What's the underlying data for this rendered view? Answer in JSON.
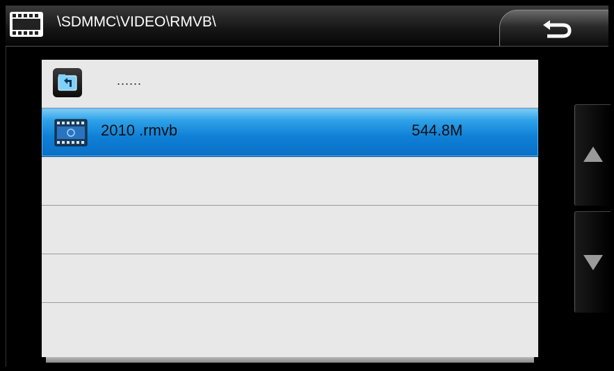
{
  "header": {
    "path": "\\SDMMC\\VIDEO\\RMVB\\",
    "icon": "film-icon",
    "back_icon": "back-arrow-icon"
  },
  "file_list": {
    "items": [
      {
        "type": "parent-folder",
        "label": "......",
        "size": ""
      },
      {
        "type": "video-file",
        "label": "2010 .rmvb",
        "size": "544.8M",
        "selected": true
      },
      {
        "type": "empty",
        "label": "",
        "size": ""
      },
      {
        "type": "empty",
        "label": "",
        "size": ""
      },
      {
        "type": "empty",
        "label": "",
        "size": ""
      },
      {
        "type": "empty",
        "label": "",
        "size": ""
      }
    ]
  },
  "scroll": {
    "up_icon": "triangle-up-icon",
    "down_icon": "triangle-down-icon"
  },
  "colors": {
    "selection": "#1a8ee0",
    "list_bg": "#e8e8e8",
    "header_bg": "#1a1a1a"
  }
}
